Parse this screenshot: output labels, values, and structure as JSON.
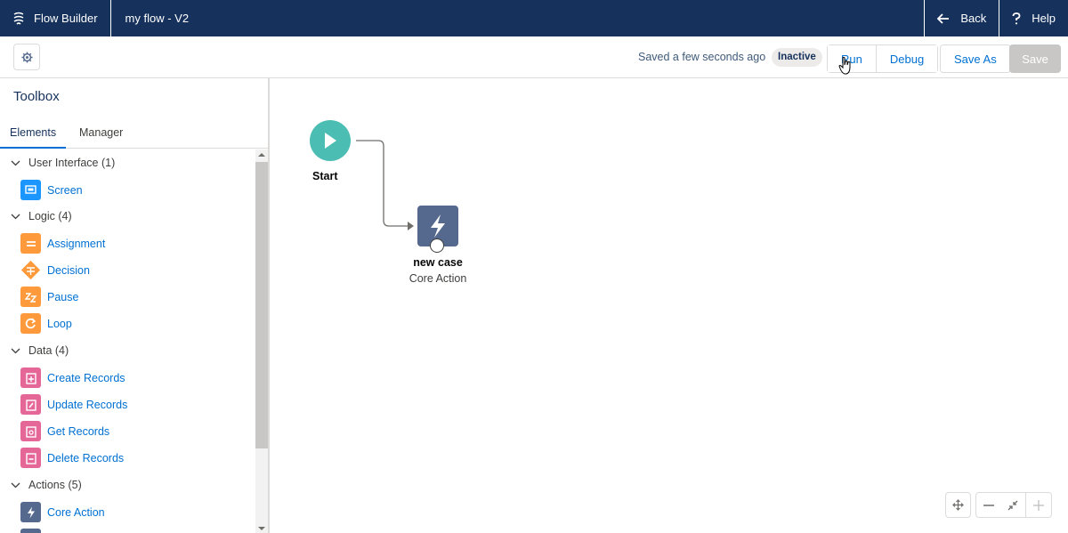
{
  "topbar": {
    "app_name": "Flow Builder",
    "flow_name": "my flow - V2",
    "back_label": "Back",
    "help_label": "Help"
  },
  "toolbar": {
    "saved_status": "Saved a few seconds ago",
    "status_badge": "Inactive",
    "run_label": "Run",
    "debug_label": "Debug",
    "save_as_label": "Save As",
    "save_label": "Save"
  },
  "toolbox": {
    "title": "Toolbox",
    "tabs": [
      {
        "label": "Elements",
        "active": true
      },
      {
        "label": "Manager",
        "active": false
      }
    ],
    "groups": [
      {
        "label": "User Interface (1)",
        "items": [
          {
            "label": "Screen",
            "icon": "screen-icon",
            "color": "#1b96ff"
          }
        ]
      },
      {
        "label": "Logic (4)",
        "items": [
          {
            "label": "Assignment",
            "icon": "assignment-icon",
            "color": "#ff9a3c"
          },
          {
            "label": "Decision",
            "icon": "decision-icon",
            "color": "#ff9a3c"
          },
          {
            "label": "Pause",
            "icon": "pause-icon",
            "color": "#ff9a3c"
          },
          {
            "label": "Loop",
            "icon": "loop-icon",
            "color": "#ff9a3c"
          }
        ]
      },
      {
        "label": "Data (4)",
        "items": [
          {
            "label": "Create Records",
            "icon": "create-records-icon",
            "color": "#e56798"
          },
          {
            "label": "Update Records",
            "icon": "update-records-icon",
            "color": "#e56798"
          },
          {
            "label": "Get Records",
            "icon": "get-records-icon",
            "color": "#e56798"
          },
          {
            "label": "Delete Records",
            "icon": "delete-records-icon",
            "color": "#e56798"
          }
        ]
      },
      {
        "label": "Actions (5)",
        "items": [
          {
            "label": "Core Action",
            "icon": "core-action-icon",
            "color": "#54698d"
          }
        ]
      }
    ]
  },
  "canvas": {
    "start_label": "Start",
    "node": {
      "title": "new case",
      "subtitle": "Core Action",
      "icon": "lightning-icon",
      "color": "#54698d"
    }
  },
  "colors": {
    "header_bg": "#16325c",
    "start_node": "#4bbdb2",
    "link": "#0070d2"
  }
}
